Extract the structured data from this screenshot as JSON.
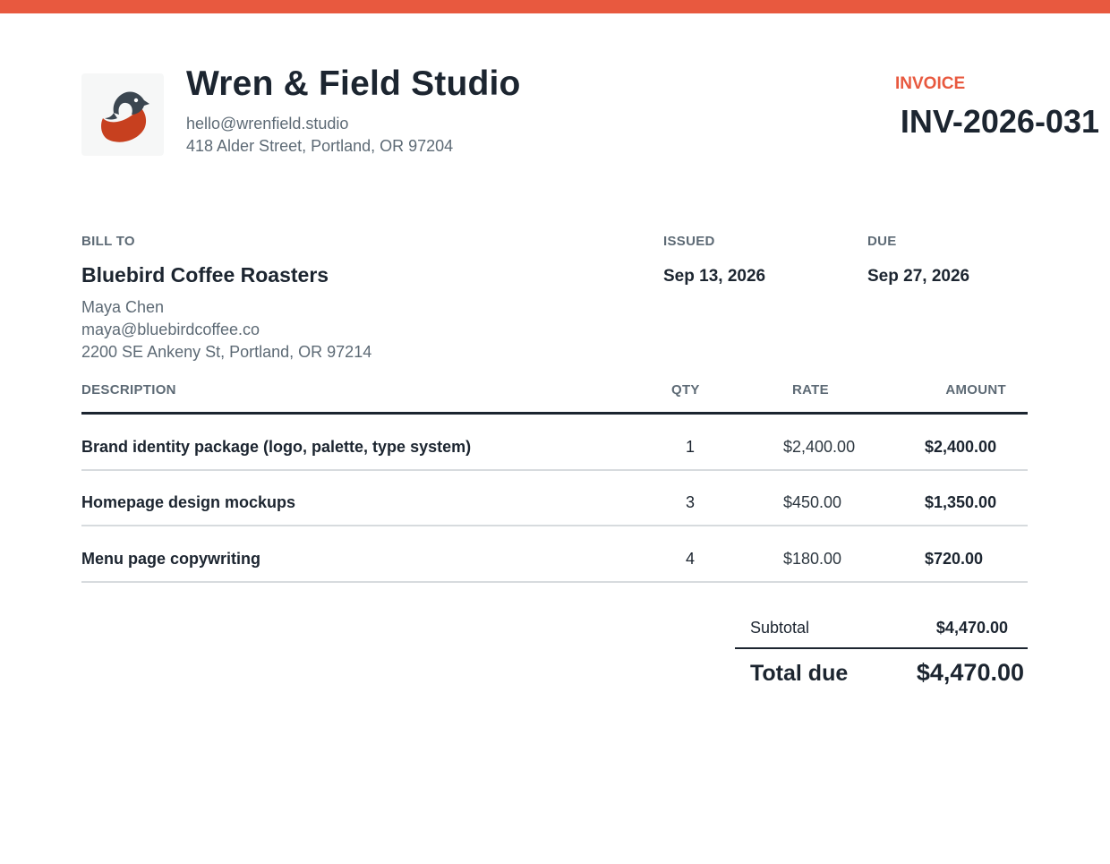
{
  "brand": {
    "accent_color": "#e8593f",
    "text_color": "#1c2530",
    "muted_color": "#5d6a75"
  },
  "studio": {
    "name": "Wren & Field Studio",
    "email": "hello@wrenfield.studio",
    "address": "418 Alder Street, Portland, OR 97204",
    "logo_icon": "wren-bird-icon"
  },
  "invoice": {
    "label": "INVOICE",
    "number": "INV-2026-031"
  },
  "bill_to": {
    "label": "BILL TO",
    "client_name": "Bluebird Coffee Roasters",
    "contact": "Maya Chen",
    "email": "maya@bluebirdcoffee.co",
    "address": "2200 SE Ankeny St, Portland, OR 97214"
  },
  "dates": {
    "issued_label": "ISSUED",
    "issued_value": "Sep 13, 2026",
    "due_label": "DUE",
    "due_value": "Sep 27, 2026"
  },
  "table": {
    "headers": {
      "description": "DESCRIPTION",
      "qty": "QTY",
      "rate": "RATE",
      "amount": "AMOUNT"
    },
    "rows": [
      {
        "description": "Brand identity package (logo, palette, type system)",
        "qty": "1",
        "rate": "$2,400.00",
        "amount": "$2,400.00"
      },
      {
        "description": "Homepage design mockups",
        "qty": "3",
        "rate": "$450.00",
        "amount": "$1,350.00"
      },
      {
        "description": "Menu page copywriting",
        "qty": "4",
        "rate": "$180.00",
        "amount": "$720.00"
      }
    ]
  },
  "totals": {
    "subtotal_label": "Subtotal",
    "subtotal_value": "$4,470.00",
    "total_label": "Total due",
    "total_value": "$4,470.00"
  }
}
